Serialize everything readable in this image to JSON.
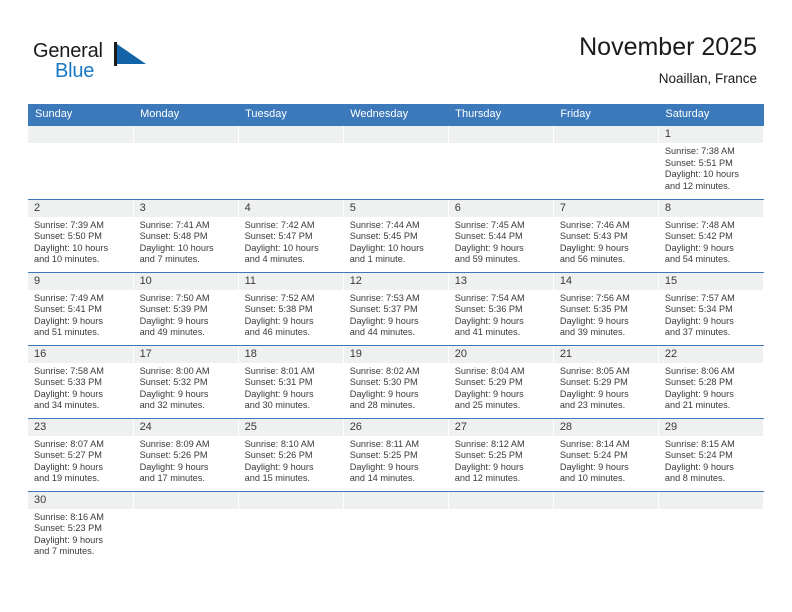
{
  "logo": {
    "text_top": "General",
    "text_bottom": "Blue",
    "flag_icon": "blue-triangle-flag-icon",
    "brand_color": "#1878c4"
  },
  "header": {
    "title": "November 2025",
    "subtitle": "Noaillan, France"
  },
  "colors": {
    "header_row": "#3b79ba",
    "daynum_strip": "#eff0f0",
    "text": "#3a3a3a",
    "accent": "#1878c4"
  },
  "weekdays": [
    "Sunday",
    "Monday",
    "Tuesday",
    "Wednesday",
    "Thursday",
    "Friday",
    "Saturday"
  ],
  "weeks": [
    [
      {
        "day": "",
        "lines": []
      },
      {
        "day": "",
        "lines": []
      },
      {
        "day": "",
        "lines": []
      },
      {
        "day": "",
        "lines": []
      },
      {
        "day": "",
        "lines": []
      },
      {
        "day": "",
        "lines": []
      },
      {
        "day": "1",
        "lines": [
          "Sunrise: 7:38 AM",
          "Sunset: 5:51 PM",
          "Daylight: 10 hours",
          "and 12 minutes."
        ]
      }
    ],
    [
      {
        "day": "2",
        "lines": [
          "Sunrise: 7:39 AM",
          "Sunset: 5:50 PM",
          "Daylight: 10 hours",
          "and 10 minutes."
        ]
      },
      {
        "day": "3",
        "lines": [
          "Sunrise: 7:41 AM",
          "Sunset: 5:48 PM",
          "Daylight: 10 hours",
          "and 7 minutes."
        ]
      },
      {
        "day": "4",
        "lines": [
          "Sunrise: 7:42 AM",
          "Sunset: 5:47 PM",
          "Daylight: 10 hours",
          "and 4 minutes."
        ]
      },
      {
        "day": "5",
        "lines": [
          "Sunrise: 7:44 AM",
          "Sunset: 5:45 PM",
          "Daylight: 10 hours",
          "and 1 minute."
        ]
      },
      {
        "day": "6",
        "lines": [
          "Sunrise: 7:45 AM",
          "Sunset: 5:44 PM",
          "Daylight: 9 hours",
          "and 59 minutes."
        ]
      },
      {
        "day": "7",
        "lines": [
          "Sunrise: 7:46 AM",
          "Sunset: 5:43 PM",
          "Daylight: 9 hours",
          "and 56 minutes."
        ]
      },
      {
        "day": "8",
        "lines": [
          "Sunrise: 7:48 AM",
          "Sunset: 5:42 PM",
          "Daylight: 9 hours",
          "and 54 minutes."
        ]
      }
    ],
    [
      {
        "day": "9",
        "lines": [
          "Sunrise: 7:49 AM",
          "Sunset: 5:41 PM",
          "Daylight: 9 hours",
          "and 51 minutes."
        ]
      },
      {
        "day": "10",
        "lines": [
          "Sunrise: 7:50 AM",
          "Sunset: 5:39 PM",
          "Daylight: 9 hours",
          "and 49 minutes."
        ]
      },
      {
        "day": "11",
        "lines": [
          "Sunrise: 7:52 AM",
          "Sunset: 5:38 PM",
          "Daylight: 9 hours",
          "and 46 minutes."
        ]
      },
      {
        "day": "12",
        "lines": [
          "Sunrise: 7:53 AM",
          "Sunset: 5:37 PM",
          "Daylight: 9 hours",
          "and 44 minutes."
        ]
      },
      {
        "day": "13",
        "lines": [
          "Sunrise: 7:54 AM",
          "Sunset: 5:36 PM",
          "Daylight: 9 hours",
          "and 41 minutes."
        ]
      },
      {
        "day": "14",
        "lines": [
          "Sunrise: 7:56 AM",
          "Sunset: 5:35 PM",
          "Daylight: 9 hours",
          "and 39 minutes."
        ]
      },
      {
        "day": "15",
        "lines": [
          "Sunrise: 7:57 AM",
          "Sunset: 5:34 PM",
          "Daylight: 9 hours",
          "and 37 minutes."
        ]
      }
    ],
    [
      {
        "day": "16",
        "lines": [
          "Sunrise: 7:58 AM",
          "Sunset: 5:33 PM",
          "Daylight: 9 hours",
          "and 34 minutes."
        ]
      },
      {
        "day": "17",
        "lines": [
          "Sunrise: 8:00 AM",
          "Sunset: 5:32 PM",
          "Daylight: 9 hours",
          "and 32 minutes."
        ]
      },
      {
        "day": "18",
        "lines": [
          "Sunrise: 8:01 AM",
          "Sunset: 5:31 PM",
          "Daylight: 9 hours",
          "and 30 minutes."
        ]
      },
      {
        "day": "19",
        "lines": [
          "Sunrise: 8:02 AM",
          "Sunset: 5:30 PM",
          "Daylight: 9 hours",
          "and 28 minutes."
        ]
      },
      {
        "day": "20",
        "lines": [
          "Sunrise: 8:04 AM",
          "Sunset: 5:29 PM",
          "Daylight: 9 hours",
          "and 25 minutes."
        ]
      },
      {
        "day": "21",
        "lines": [
          "Sunrise: 8:05 AM",
          "Sunset: 5:29 PM",
          "Daylight: 9 hours",
          "and 23 minutes."
        ]
      },
      {
        "day": "22",
        "lines": [
          "Sunrise: 8:06 AM",
          "Sunset: 5:28 PM",
          "Daylight: 9 hours",
          "and 21 minutes."
        ]
      }
    ],
    [
      {
        "day": "23",
        "lines": [
          "Sunrise: 8:07 AM",
          "Sunset: 5:27 PM",
          "Daylight: 9 hours",
          "and 19 minutes."
        ]
      },
      {
        "day": "24",
        "lines": [
          "Sunrise: 8:09 AM",
          "Sunset: 5:26 PM",
          "Daylight: 9 hours",
          "and 17 minutes."
        ]
      },
      {
        "day": "25",
        "lines": [
          "Sunrise: 8:10 AM",
          "Sunset: 5:26 PM",
          "Daylight: 9 hours",
          "and 15 minutes."
        ]
      },
      {
        "day": "26",
        "lines": [
          "Sunrise: 8:11 AM",
          "Sunset: 5:25 PM",
          "Daylight: 9 hours",
          "and 14 minutes."
        ]
      },
      {
        "day": "27",
        "lines": [
          "Sunrise: 8:12 AM",
          "Sunset: 5:25 PM",
          "Daylight: 9 hours",
          "and 12 minutes."
        ]
      },
      {
        "day": "28",
        "lines": [
          "Sunrise: 8:14 AM",
          "Sunset: 5:24 PM",
          "Daylight: 9 hours",
          "and 10 minutes."
        ]
      },
      {
        "day": "29",
        "lines": [
          "Sunrise: 8:15 AM",
          "Sunset: 5:24 PM",
          "Daylight: 9 hours",
          "and 8 minutes."
        ]
      }
    ],
    [
      {
        "day": "30",
        "lines": [
          "Sunrise: 8:16 AM",
          "Sunset: 5:23 PM",
          "Daylight: 9 hours",
          "and 7 minutes."
        ]
      },
      {
        "day": "",
        "lines": []
      },
      {
        "day": "",
        "lines": []
      },
      {
        "day": "",
        "lines": []
      },
      {
        "day": "",
        "lines": []
      },
      {
        "day": "",
        "lines": []
      },
      {
        "day": "",
        "lines": []
      }
    ]
  ]
}
